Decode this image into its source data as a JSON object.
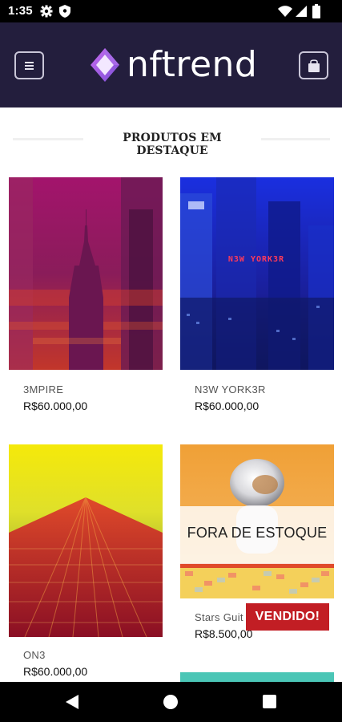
{
  "status_bar": {
    "time": "1:35",
    "icons": [
      "gear-icon",
      "shield-icon",
      "wifi-icon",
      "signal-icon",
      "battery-icon"
    ]
  },
  "header": {
    "logo_text": "nftrend",
    "menu_icon": "hamburger-menu-icon",
    "cart_icon": "shopping-bag-icon",
    "background_color": "#231e3d"
  },
  "section": {
    "title": "PRODUTOS EM DESTAQUE"
  },
  "products": [
    {
      "name": "3MPIRE",
      "price": "R$60.000,00",
      "image_icon": "empire-building-artwork"
    },
    {
      "name": "N3W YORK3R",
      "price": "R$60.000,00",
      "image_icon": "new-yorker-city-artwork",
      "image_text": "N3W YORK3R"
    },
    {
      "name": "ON3",
      "price": "R$60.000,00",
      "image_icon": "one-tower-artwork"
    },
    {
      "name": "Stars Guit",
      "price": "R$8.500,00",
      "image_icon": "astronaut-helmet-artwork",
      "out_of_stock_label": "FORA DE ESTOQUE",
      "sold_label": "VENDIDO!"
    }
  ],
  "colors": {
    "sold_badge": "#c21e24",
    "teal_card_edge": "#4bc6b6"
  },
  "nav_bar": {
    "icons": [
      "back-icon",
      "home-icon",
      "recents-icon"
    ]
  }
}
